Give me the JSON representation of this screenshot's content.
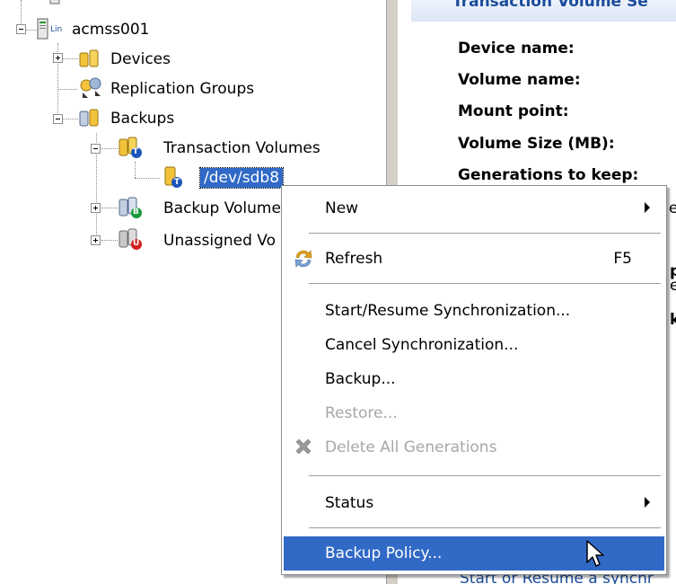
{
  "tree": {
    "root": {
      "label": "acmss001",
      "badge": "Lin"
    },
    "devices": "Devices",
    "replication_groups": "Replication Groups",
    "backups": "Backups",
    "transaction_volumes": "Transaction Volumes",
    "selected_volume": "/dev/sdb8",
    "backup_volumes": "Backup Volume",
    "unassigned_volumes": "Unassigned Vo",
    "badges": {
      "transaction": "T",
      "backup": "B",
      "unassigned": "U"
    }
  },
  "detail": {
    "header": "Transaction Volume Se",
    "fields": [
      "Device name:",
      "Volume name:",
      "Mount point:",
      "Volume Size (MB):",
      "Generations to keep:"
    ],
    "fragments": [
      "e",
      "p",
      "e",
      "k"
    ],
    "footer_link": "Start or Resume a synchr"
  },
  "context_menu": {
    "items": [
      {
        "label": "New",
        "submenu": true
      },
      {
        "label": "Refresh",
        "shortcut": "F5",
        "icon": "refresh-icon"
      },
      {
        "label": "Start/Resume Synchronization..."
      },
      {
        "label": "Cancel Synchronization..."
      },
      {
        "label": "Backup..."
      },
      {
        "label": "Restore...",
        "disabled": true
      },
      {
        "label": "Delete All Generations",
        "disabled": true,
        "icon": "delete-icon"
      },
      {
        "label": "Status",
        "submenu": true
      },
      {
        "label": "Backup Policy...",
        "highlighted": true
      }
    ]
  },
  "colors": {
    "selection": "#3169c6",
    "disabled_text": "#a7a7a7",
    "header_text": "#1c4d9c"
  }
}
